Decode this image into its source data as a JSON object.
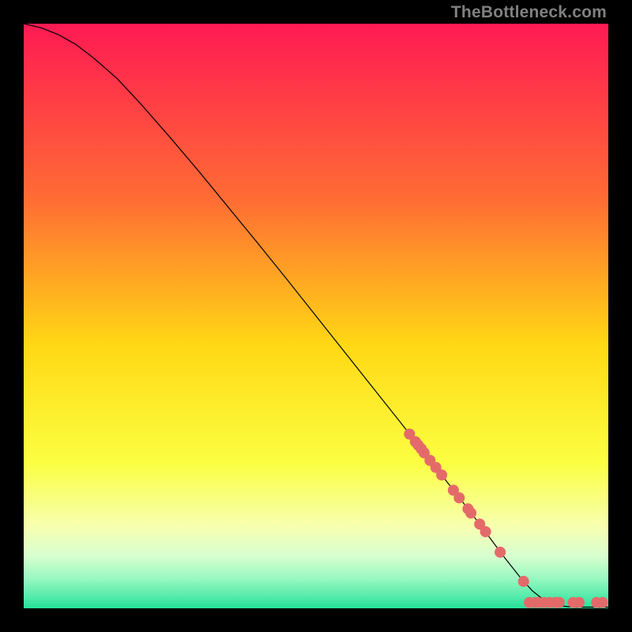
{
  "watermark": "TheBottleneck.com",
  "chart_data": {
    "type": "line",
    "title": "",
    "xlabel": "",
    "ylabel": "",
    "xlim": [
      0,
      100
    ],
    "ylim": [
      0,
      100
    ],
    "background_gradient": {
      "stops": [
        {
          "pct": 0,
          "color": "#ff1a53"
        },
        {
          "pct": 30,
          "color": "#ff6c34"
        },
        {
          "pct": 55,
          "color": "#ffd814"
        },
        {
          "pct": 75,
          "color": "#fbff41"
        },
        {
          "pct": 86,
          "color": "#f7ffb0"
        },
        {
          "pct": 91,
          "color": "#d8ffcf"
        },
        {
          "pct": 95,
          "color": "#97f7c0"
        },
        {
          "pct": 100,
          "color": "#26e29a"
        }
      ]
    },
    "series": [
      {
        "name": "curve",
        "kind": "line",
        "color": "#000000",
        "points": [
          {
            "x": 0,
            "y": 100
          },
          {
            "x": 3,
            "y": 99.3
          },
          {
            "x": 6,
            "y": 98.1
          },
          {
            "x": 9,
            "y": 96.4
          },
          {
            "x": 12,
            "y": 94.1
          },
          {
            "x": 16,
            "y": 90.6
          },
          {
            "x": 20,
            "y": 86.3
          },
          {
            "x": 25,
            "y": 80.6
          },
          {
            "x": 30,
            "y": 74.7
          },
          {
            "x": 35,
            "y": 68.6
          },
          {
            "x": 40,
            "y": 62.5
          },
          {
            "x": 45,
            "y": 56.3
          },
          {
            "x": 50,
            "y": 50.0
          },
          {
            "x": 55,
            "y": 43.7
          },
          {
            "x": 60,
            "y": 37.4
          },
          {
            "x": 65,
            "y": 31.1
          },
          {
            "x": 70,
            "y": 24.7
          },
          {
            "x": 74,
            "y": 19.6
          },
          {
            "x": 78,
            "y": 14.4
          },
          {
            "x": 82,
            "y": 9.0
          },
          {
            "x": 85,
            "y": 5.2
          },
          {
            "x": 87,
            "y": 3.0
          },
          {
            "x": 89,
            "y": 1.4
          },
          {
            "x": 91,
            "y": 0.5
          },
          {
            "x": 94,
            "y": 0.2
          },
          {
            "x": 100,
            "y": 0.2
          }
        ]
      },
      {
        "name": "dots",
        "kind": "scatter",
        "color": "#e46a6a",
        "radius": 7,
        "points": [
          {
            "x": 66,
            "y": 29.8
          },
          {
            "x": 67,
            "y": 28.5
          },
          {
            "x": 67.5,
            "y": 27.9
          },
          {
            "x": 68,
            "y": 27.3
          },
          {
            "x": 68.5,
            "y": 26.6
          },
          {
            "x": 69.5,
            "y": 25.3
          },
          {
            "x": 70.5,
            "y": 24.1
          },
          {
            "x": 71.5,
            "y": 22.8
          },
          {
            "x": 73.5,
            "y": 20.2
          },
          {
            "x": 74.5,
            "y": 18.9
          },
          {
            "x": 76,
            "y": 17.0
          },
          {
            "x": 76.5,
            "y": 16.3
          },
          {
            "x": 78,
            "y": 14.4
          },
          {
            "x": 79,
            "y": 13.1
          },
          {
            "x": 81.5,
            "y": 9.6
          },
          {
            "x": 85.5,
            "y": 4.6
          },
          {
            "x": 86.5,
            "y": 1.0
          },
          {
            "x": 87.5,
            "y": 1.0
          },
          {
            "x": 88,
            "y": 1.0
          },
          {
            "x": 89,
            "y": 1.0
          },
          {
            "x": 90,
            "y": 1.0
          },
          {
            "x": 91,
            "y": 1.0
          },
          {
            "x": 91.6,
            "y": 1.0
          },
          {
            "x": 94,
            "y": 1.0
          },
          {
            "x": 95,
            "y": 1.0
          },
          {
            "x": 98,
            "y": 1.0
          },
          {
            "x": 99,
            "y": 1.0
          }
        ]
      }
    ]
  }
}
